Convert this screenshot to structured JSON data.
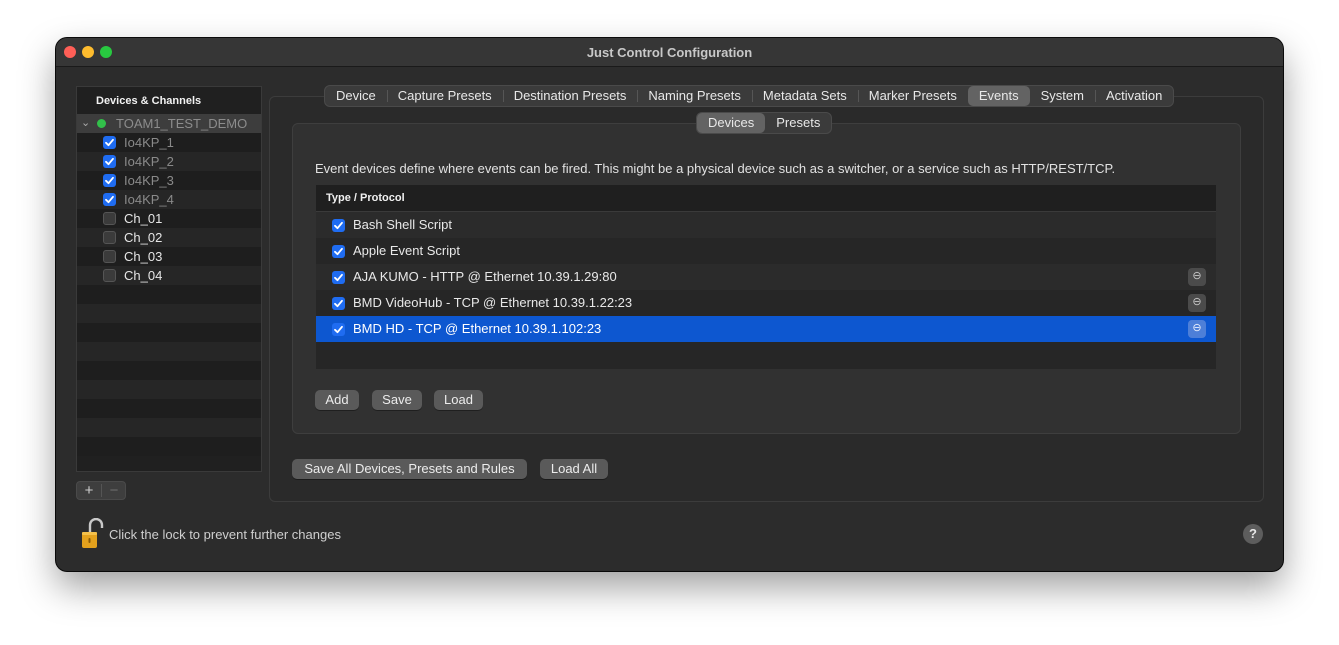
{
  "window": {
    "title": "Just Control Configuration"
  },
  "sidebar": {
    "header": "Devices & Channels",
    "group": {
      "label": "TOAM1_TEST_DEMO",
      "status_color": "#32c04a"
    },
    "items": [
      {
        "label": "Io4KP_1",
        "checked": true
      },
      {
        "label": "Io4KP_2",
        "checked": true
      },
      {
        "label": "Io4KP_3",
        "checked": true
      },
      {
        "label": "Io4KP_4",
        "checked": true
      },
      {
        "label": "Ch_01",
        "checked": false
      },
      {
        "label": "Ch_02",
        "checked": false
      },
      {
        "label": "Ch_03",
        "checked": false
      },
      {
        "label": "Ch_04",
        "checked": false
      }
    ],
    "add_label": "+",
    "remove_label": "−"
  },
  "tabs": [
    {
      "label": "Device",
      "active": false
    },
    {
      "label": "Capture Presets",
      "active": false
    },
    {
      "label": "Destination Presets",
      "active": false
    },
    {
      "label": "Naming Presets",
      "active": false
    },
    {
      "label": "Metadata Sets",
      "active": false
    },
    {
      "label": "Marker Presets",
      "active": false
    },
    {
      "label": "Events",
      "active": true
    },
    {
      "label": "System",
      "active": false
    },
    {
      "label": "Activation",
      "active": false
    }
  ],
  "subtabs": [
    {
      "label": "Devices",
      "active": true
    },
    {
      "label": "Presets",
      "active": false
    }
  ],
  "events": {
    "description": "Event devices define where events can be fired. This might be a physical device such as a switcher, or a service such as HTTP/REST/TCP.",
    "column_header": "Type / Protocol",
    "rows": [
      {
        "label": "Bash Shell Script",
        "checked": true,
        "info": false,
        "selected": false
      },
      {
        "label": "Apple Event Script",
        "checked": true,
        "info": false,
        "selected": false
      },
      {
        "label": "AJA KUMO - HTTP @ Ethernet 10.39.1.29:80",
        "checked": true,
        "info": true,
        "selected": false
      },
      {
        "label": "BMD VideoHub - TCP @ Ethernet 10.39.1.22:23",
        "checked": true,
        "info": true,
        "selected": false
      },
      {
        "label": "BMD HD - TCP @ Ethernet 10.39.1.102:23",
        "checked": true,
        "info": true,
        "selected": true
      }
    ],
    "add_label": "Add",
    "save_label": "Save",
    "load_label": "Load",
    "info_glyph": "⊖"
  },
  "footer": {
    "save_all_label": "Save All Devices, Presets and Rules",
    "load_all_label": "Load All",
    "lock_label": "Click the lock to prevent further changes",
    "help_label": "?"
  },
  "colors": {
    "accent": "#1f6cf1",
    "selection": "#0d57d0",
    "window_bg": "#2c2c2c"
  }
}
